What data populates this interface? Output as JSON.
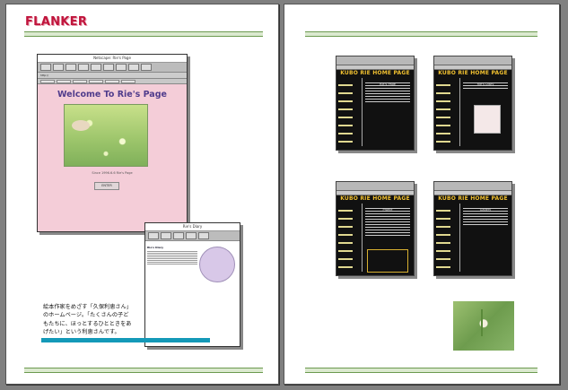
{
  "brand": "FLANKER",
  "browser_window": {
    "title": "Netscape: Rie's Page",
    "url": "http://",
    "page_heading": "Welcome To Rie's Page",
    "caption": "Since 1996.6.6 Rie's Page",
    "enter_button": "ENTER"
  },
  "article_window": {
    "title": "Rie's Diary",
    "article_title": "Rie's Diary",
    "text": ""
  },
  "description": [
    "絵本作家をめざす「久保利恵さん」",
    "のホームページ。「たくさんの子ど",
    "もたちに、ほっとするひとときをあ",
    "げたい」という利恵さんです。"
  ],
  "kubo_windows": [
    {
      "heading": "KUBO RIE HOME PAGE",
      "main_title": "Rie's Page"
    },
    {
      "heading": "KUBO RIE HOME PAGE",
      "main_title": "Rie's Diary"
    },
    {
      "heading": "KUBO RIE HOME PAGE",
      "main_title": "Profile"
    },
    {
      "heading": "KUBO RIE HOME PAGE",
      "main_title": "Gallery"
    }
  ],
  "colors": {
    "brand": "#c0143c",
    "accent_bar": "#1499b8",
    "rule_green": "#6c9a50"
  }
}
